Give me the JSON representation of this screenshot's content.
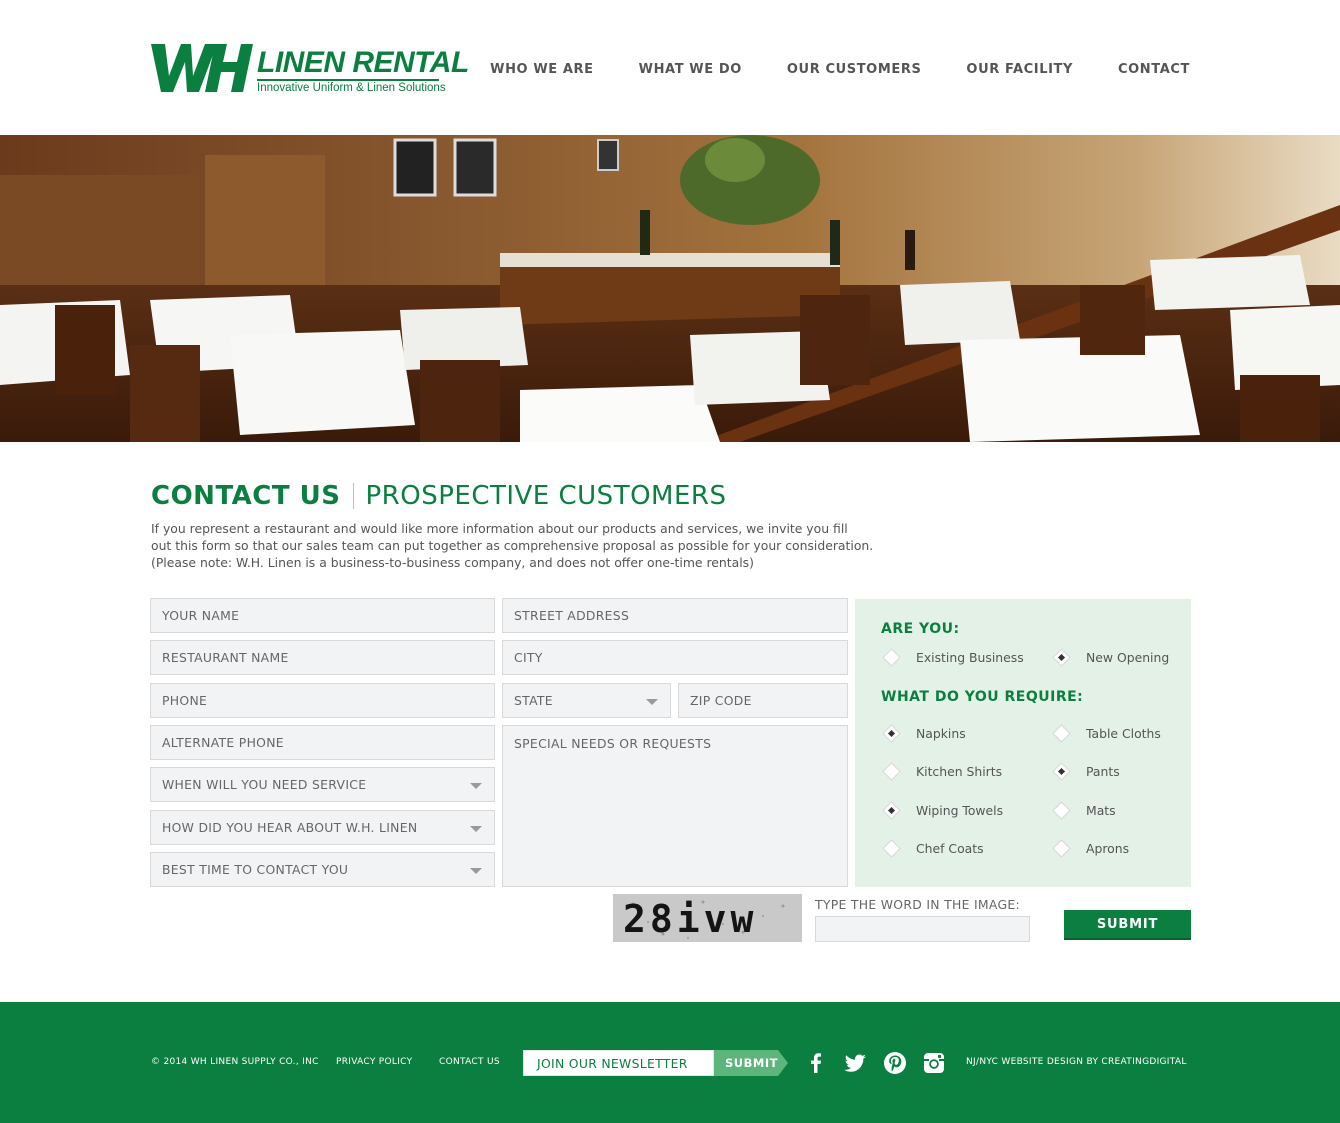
{
  "brand": {
    "name": "LINEN RENTAL",
    "tagline": "Innovative Uniform & Linen Solutions",
    "color": "#0a7f3f"
  },
  "nav": {
    "items": [
      "WHO WE ARE",
      "WHAT WE DO",
      "OUR CUSTOMERS",
      "OUR FACILITY",
      "CONTACT"
    ]
  },
  "page": {
    "title": "CONTACT US",
    "subtitle": "PROSPECTIVE CUSTOMERS",
    "intro": [
      "If you represent a restaurant and would like more information about our products and services, we invite you fill",
      "out this form so that our sales team can put together as comprehensive proposal as possible for your consideration.",
      "(Please note: W.H. Linen is a business-to-business company, and does not offer one-time rentals)"
    ]
  },
  "form": {
    "your_name": "YOUR NAME",
    "restaurant_name": "RESTAURANT NAME",
    "phone": "PHONE",
    "alternate_phone": "ALTERNATE PHONE",
    "when_service": "WHEN WILL YOU NEED SERVICE",
    "how_heard": "HOW DID YOU HEAR ABOUT W.H. LINEN",
    "best_time": "BEST TIME TO CONTACT YOU",
    "street": "STREET ADDRESS",
    "city": "CITY",
    "state": "STATE",
    "zip": "ZIP CODE",
    "special": "SPECIAL NEEDS OR REQUESTS"
  },
  "options": {
    "are_you_heading": "ARE YOU:",
    "are_you": [
      {
        "label": "Existing Business",
        "selected": false
      },
      {
        "label": "New Opening",
        "selected": true
      }
    ],
    "require_heading": "WHAT DO YOU REQUIRE:",
    "require": [
      {
        "label": "Napkins",
        "selected": true
      },
      {
        "label": "Table Cloths",
        "selected": false
      },
      {
        "label": "Kitchen Shirts",
        "selected": false
      },
      {
        "label": "Pants",
        "selected": true
      },
      {
        "label": "Wiping Towels",
        "selected": true
      },
      {
        "label": "Mats",
        "selected": false
      },
      {
        "label": "Chef Coats",
        "selected": false
      },
      {
        "label": "Aprons",
        "selected": false
      }
    ]
  },
  "captcha": {
    "image_text": "28ivw",
    "label": "TYPE THE WORD IN THE IMAGE:",
    "value": ""
  },
  "submit_label": "SUBMIT",
  "footer": {
    "copyright": "© 2014 WH LINEN SUPPLY CO., INC",
    "privacy": "PRIVACY POLICY",
    "contact": "CONTACT US",
    "newsletter_placeholder": "JOIN OUR NEWSLETTER",
    "newsletter_submit": "SUBMIT",
    "credit": "NJ/NYC WEBSITE DESIGN BY CREATINGDIGITAL",
    "social": [
      "facebook-icon",
      "twitter-icon",
      "pinterest-icon",
      "instagram-icon"
    ]
  }
}
